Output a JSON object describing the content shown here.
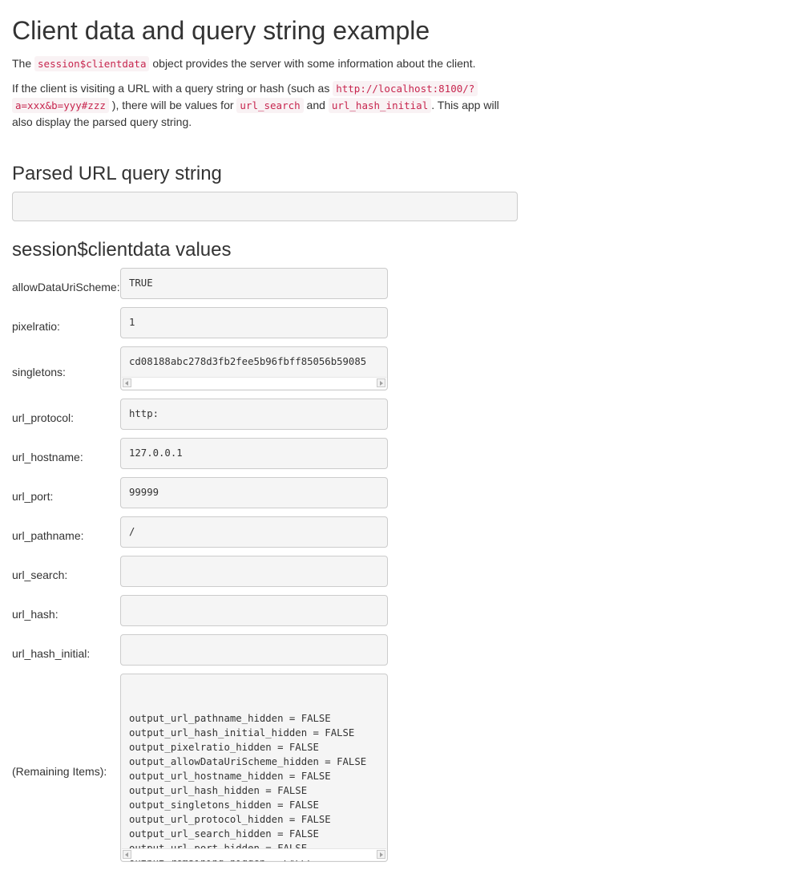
{
  "title": "Client data and query string example",
  "intro": {
    "p1_before": "The ",
    "p1_code": "session$clientdata",
    "p1_after": " object provides the server with some information about the client.",
    "p2_part1": "If the client is visiting a URL with a query string or hash (such as ",
    "p2_code_url_line1": "http://localhost:8100/?",
    "p2_code_url_line2": "a=xxx&b=yyy#zzz",
    "p2_part2": " ), there will be values for ",
    "p2_code_search": "url_search",
    "p2_part3": " and ",
    "p2_code_hash": "url_hash_initial",
    "p2_part4": ". This app will",
    "p2_part5": "also display the parsed query string."
  },
  "parsed": {
    "heading": "Parsed URL query string",
    "value": ""
  },
  "clientdata": {
    "heading": "session$clientdata values",
    "fields": [
      {
        "label": "allowDataUriScheme:",
        "value": "TRUE"
      },
      {
        "label": "pixelratio:",
        "value": "1"
      },
      {
        "label": "singletons:",
        "value": "cd08188abc278d3fb2fee5b96fbff85056b59085"
      },
      {
        "label": "url_protocol:",
        "value": "http:"
      },
      {
        "label": "url_hostname:",
        "value": "127.0.0.1"
      },
      {
        "label": "url_port:",
        "value": "99999"
      },
      {
        "label": "url_pathname:",
        "value": "/"
      },
      {
        "label": "url_search:",
        "value": ""
      },
      {
        "label": "url_hash:",
        "value": ""
      },
      {
        "label": "url_hash_initial:",
        "value": ""
      }
    ],
    "remaining_label": "(Remaining Items):",
    "remaining_items": [
      "output_url_pathname_hidden = FALSE",
      "output_url_hash_initial_hidden = FALSE",
      "output_pixelratio_hidden = FALSE",
      "output_allowDataUriScheme_hidden = FALSE",
      "output_url_hostname_hidden = FALSE",
      "output_url_hash_hidden = FALSE",
      "output_singletons_hidden = FALSE",
      "output_url_protocol_hidden = FALSE",
      "output_url_search_hidden = FALSE",
      "output_url_port_hidden = FALSE",
      "output_remaining_hidden = FALSE"
    ]
  }
}
